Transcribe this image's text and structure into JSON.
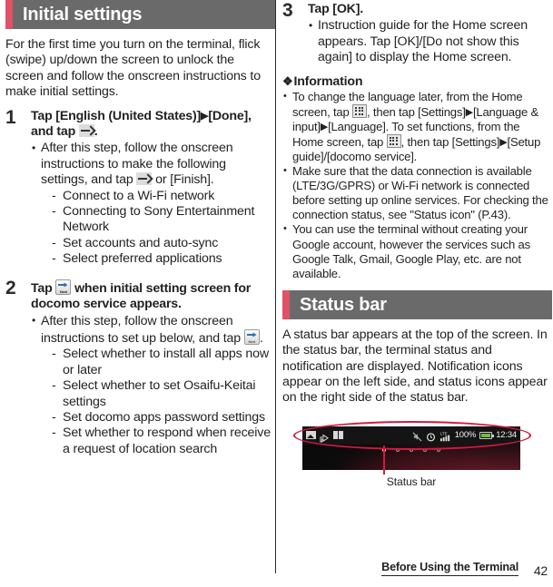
{
  "document": {
    "footer": {
      "chapter": "Before Using the Terminal",
      "page_number": "42"
    }
  },
  "left_column": {
    "section": {
      "title": "Initial settings",
      "accent_color": "#e05266",
      "header_bg": "#6a6a6a"
    },
    "intro": "For the first time you turn on the terminal, flick (swipe) up/down the screen to unlock the screen and follow the onscreen instructions to make initial settings.",
    "steps": [
      {
        "number": "1",
        "title_part1": "Tap [English (United States)]",
        "title_sep": "▶",
        "title_part2": "[Done], and tap",
        "title_icon": "arrow-right-icon",
        "title_end": ".",
        "bullets": [
          {
            "text_part1": "After this step, follow the onscreen instructions to make the following settings, and tap",
            "icon": "arrow-right-icon",
            "text_part2": "or [Finish].",
            "subitems": [
              "Connect to a Wi-Fi network",
              "Connecting to Sony Entertainment Network",
              "Set accounts and auto-sync",
              "Select preferred applications"
            ]
          }
        ]
      },
      {
        "number": "2",
        "title_part1": "Tap",
        "title_icon": "next-button-icon",
        "title_part2": "when initial setting screen for docomo service appears.",
        "bullets": [
          {
            "text_part1": "After this step, follow the onscreen instructions to set up below, and tap",
            "icon": "next-button-icon",
            "text_part2": ".",
            "subitems": [
              "Select whether to install all apps now or later",
              "Select whether to set Osaifu-Keitai settings",
              "Set docomo apps password settings",
              "Set whether to respond when receive a request of location search"
            ]
          }
        ]
      }
    ]
  },
  "right_column": {
    "step3": {
      "number": "3",
      "title": "Tap [OK].",
      "bullets": [
        "Instruction guide for the Home screen appears. Tap [OK]/[Do not show this again] to display the Home screen."
      ]
    },
    "information": {
      "heading": "Information",
      "diamond": "❖",
      "items": [
        {
          "segments": [
            "To change the language later, from the Home screen, tap",
            ", then tap [Settings]",
            "[Language & input]",
            "[Language]. To set functions, from the Home screen, tap",
            ", then tap [Settings]",
            "[Setup guide]/[docomo service]."
          ],
          "icon": "apps-grid-icon",
          "sep": "▶"
        },
        {
          "text": "Make sure that the data connection is available (LTE/3G/GPRS) or Wi-Fi network is connected before setting up online services. For checking the connection status, see \"Status icon\" (P.43)."
        },
        {
          "text": "You can use the terminal without creating your Google account, however the services such as Google Talk, Gmail, Google Play, etc. are not available."
        }
      ]
    },
    "section": {
      "title": "Status bar",
      "accent_color": "#e05266",
      "header_bg": "#6a6a6a"
    },
    "status_bar_text": "A status bar appears at the top of the screen. In the status bar, the terminal status and notification are displayed. Notification icons appear on the left side, and status icons appear on the right side of the status bar.",
    "figure": {
      "caption": "Status bar",
      "callout_color": "#d11a3f",
      "status_bar": {
        "left_icons": [
          "picture-icon",
          "upload-arrow-icon",
          "book-icon"
        ],
        "right_icons": [
          "mute-icon",
          "alarm-icon",
          "lte-signal-icon"
        ],
        "signal_label": "LTE",
        "battery_percent": "100%",
        "time": "12:34"
      },
      "home_dots": 5,
      "active_dot_index": 0
    }
  }
}
